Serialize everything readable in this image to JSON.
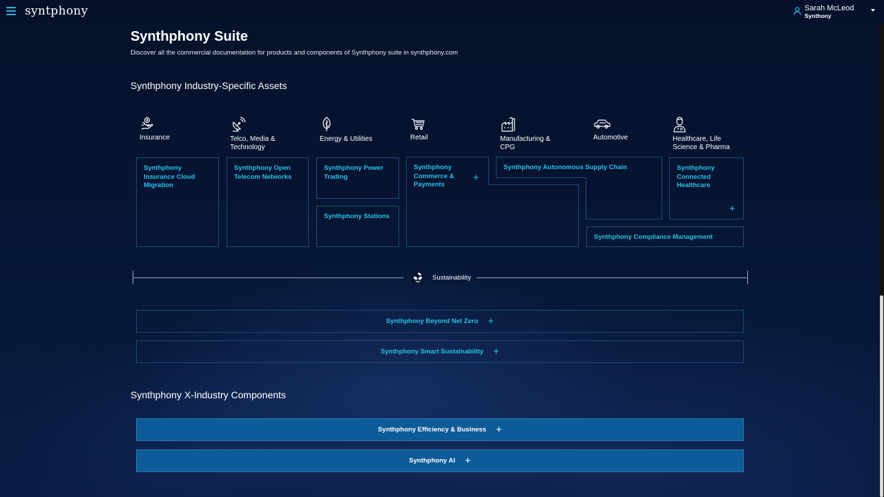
{
  "header": {
    "logo": "syntphony",
    "user_name": "Sarah McLeod",
    "user_org": "Synthony"
  },
  "page": {
    "title": "Synthphony Suite",
    "subtitle": "Discover all the commercial documentation for products and components of Synthphony suite in synthphony.com"
  },
  "industry": {
    "title": "Synthphony Industry-Specific Assets",
    "categories": [
      {
        "label": "Insurance",
        "icon": "insurance-hand-icon"
      },
      {
        "label": "Telco, Media & Technology",
        "icon": "satellite-dish-icon"
      },
      {
        "label": "Energy & Utilities",
        "icon": "leaf-icon"
      },
      {
        "label": "Retail",
        "icon": "shopping-cart-icon"
      },
      {
        "label": "Manufacturing & CPG",
        "icon": "factory-icon"
      },
      {
        "label": "Automotive",
        "icon": "car-icon"
      },
      {
        "label": "Healthcare, Life Science & Pharma",
        "icon": "doctor-icon"
      }
    ],
    "products": {
      "insurance_cloud": "Synthphony Insurance Cloud Migration",
      "telecom": "Synthphony Open Telecom Networks",
      "power_trading": "Synthphony Power Trading",
      "stations": "Synthphony Stations",
      "commerce": "Synthphony Commerce & Payments",
      "supply_chain": "Synthphony Autonomous Supply Chain",
      "healthcare": "Synthphony Connected Healthcare",
      "compliance": "Synthphony Compliance Management"
    },
    "plus": "+"
  },
  "sustainability": {
    "label": "Sustainability",
    "icon": "sustainability-leaves-icon",
    "items": [
      "Synthphony Beyond Net Zero",
      "Synthphony Smart Sustainability"
    ]
  },
  "xindustry": {
    "title": "Synthphony X-Industry Components",
    "items": [
      "Synthphony Efficiency & Business",
      "Synthphony AI"
    ]
  },
  "colors": {
    "accent": "#2bc0e4",
    "border": "#1f4a74",
    "blue_button": "#0d5b98",
    "background": "#061533"
  }
}
